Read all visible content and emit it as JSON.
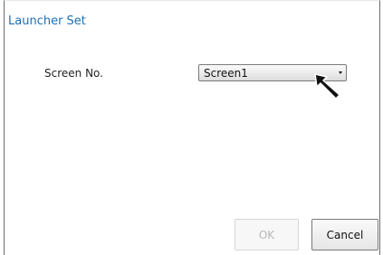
{
  "dialog": {
    "title": "Launcher Set",
    "screen_no_label": "Screen No.",
    "screen_select": {
      "value": "Screen1"
    },
    "ok_button": {
      "label": "OK",
      "enabled": false
    },
    "cancel_button": {
      "label": "Cancel"
    }
  },
  "colors": {
    "title": "#1f6fb4"
  }
}
